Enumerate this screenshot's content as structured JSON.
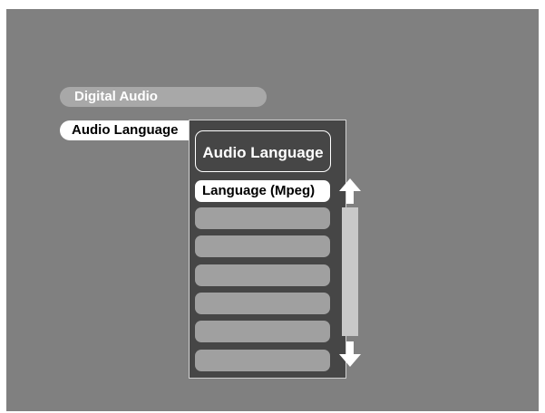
{
  "menu": {
    "items": [
      {
        "label": "Digital Audio"
      },
      {
        "label": "Audio Language"
      }
    ]
  },
  "panel": {
    "title": "Audio Language",
    "options": [
      {
        "label": "Language (Mpeg)",
        "selected": true
      },
      {
        "label": ""
      },
      {
        "label": ""
      },
      {
        "label": ""
      },
      {
        "label": ""
      },
      {
        "label": ""
      },
      {
        "label": ""
      }
    ],
    "scroll_icons": [
      "arrow-up-icon",
      "arrow-down-icon"
    ]
  },
  "colors": {
    "screen_bg": "#808080",
    "panel_bg": "#464646",
    "inactive_tab": "#a8a8a8",
    "active_tab": "#ffffff",
    "empty_option": "#a0a0a0",
    "scroll_track": "#c8c8c8"
  }
}
